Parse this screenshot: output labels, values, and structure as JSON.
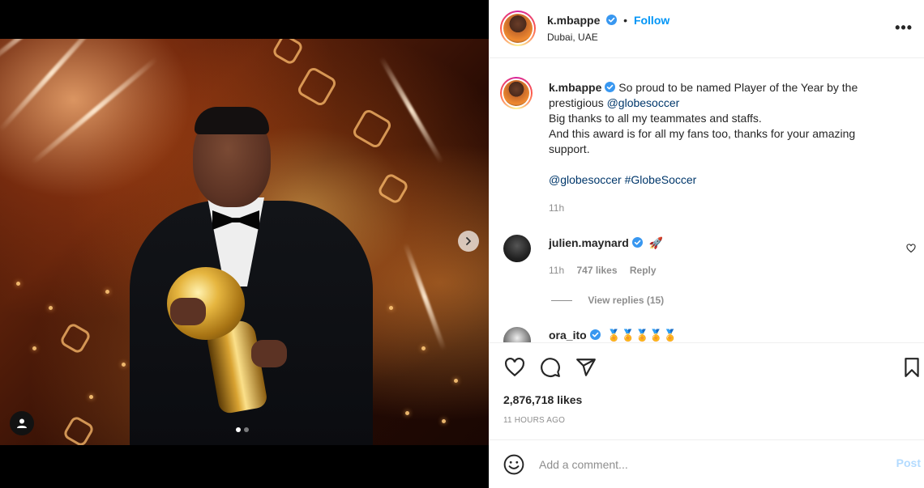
{
  "post": {
    "username": "k.mbappe",
    "follow_label": "Follow",
    "location": "Dubai, UAE",
    "more_label": "•••",
    "carousel": {
      "current": 1,
      "total": 2
    }
  },
  "caption": {
    "username": "k.mbappe",
    "line1": " So proud to be named Player of the Year by the prestigious ",
    "mention1": "@globesoccer",
    "line2": "Big thanks to all my teammates and staffs.",
    "line3": "And this award is for all my fans too, thanks for your amazing support.",
    "mention2": "@globesoccer",
    "hashtag": "#GlobeSoccer",
    "time": "11h"
  },
  "comments": [
    {
      "username": "julien.maynard",
      "text": "🚀",
      "time": "11h",
      "likes": "747 likes",
      "reply_label": "Reply",
      "view_replies": "View replies (15)"
    },
    {
      "username": "ora_ito",
      "text": "🏅🏅🏅🏅🏅"
    }
  ],
  "actions": {
    "likes": "2,876,718 likes",
    "time_ago": "11 HOURS AGO"
  },
  "compose": {
    "placeholder": "Add a comment...",
    "post_label": "Post"
  },
  "colors": {
    "accent": "#0095f6",
    "link": "#00376b",
    "muted": "#8e8e8e",
    "post_disabled": "#b3dbff"
  }
}
